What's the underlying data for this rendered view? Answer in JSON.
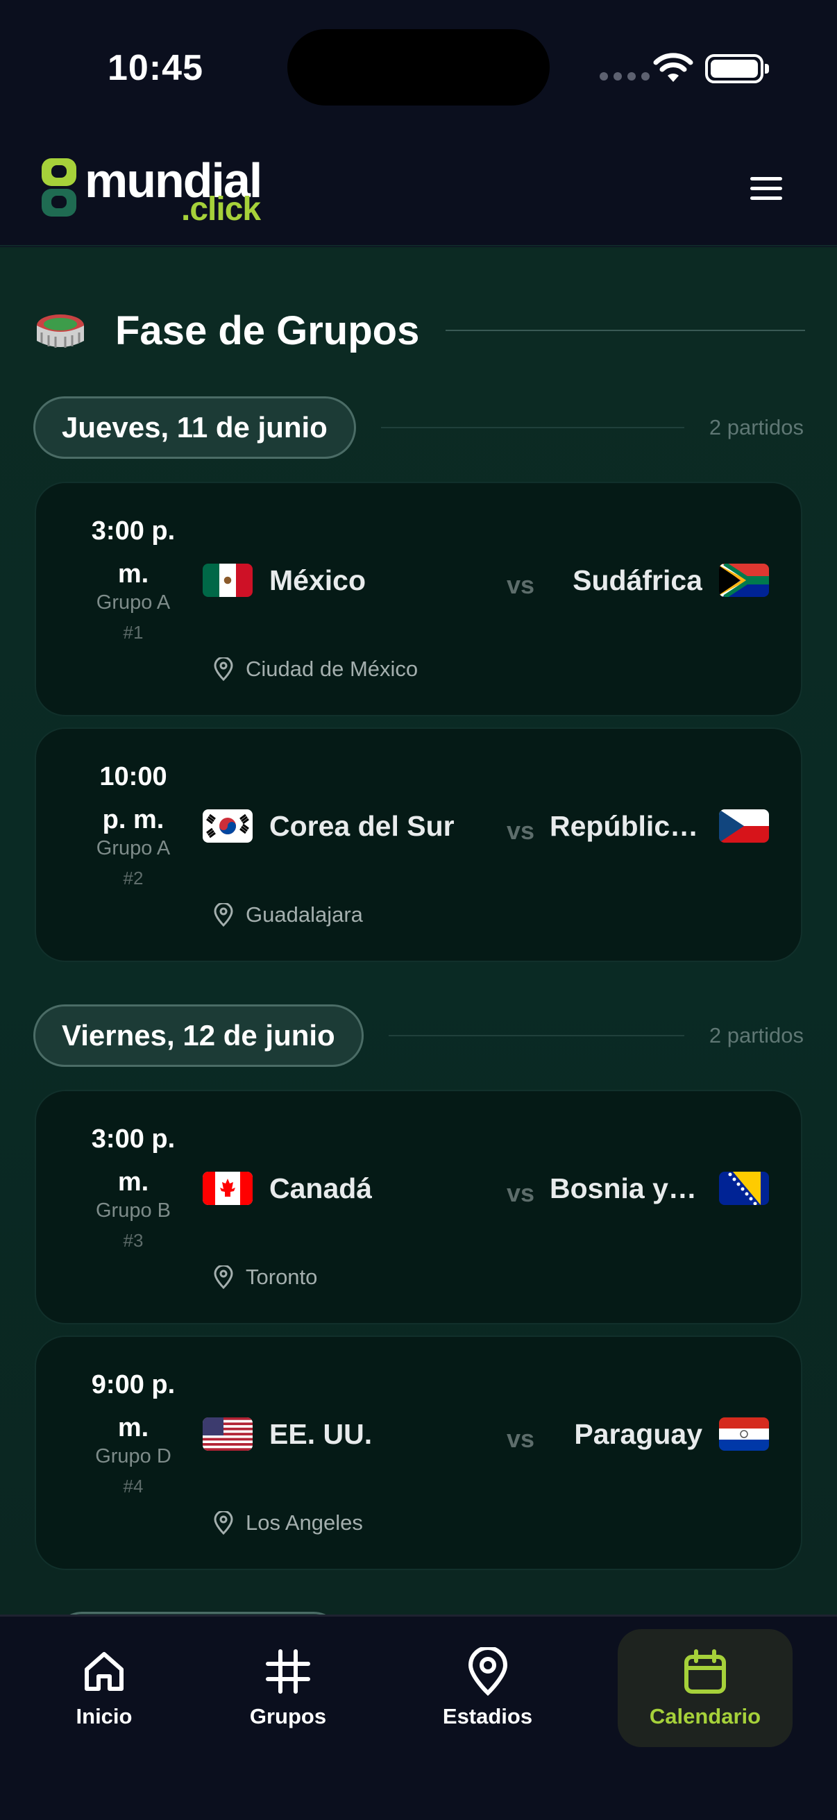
{
  "status_bar": {
    "time": "10:45"
  },
  "header": {
    "logo_text": "mundial",
    "logo_sub": ".click"
  },
  "section": {
    "title": "Fase de Grupos"
  },
  "days": [
    {
      "label": "Jueves, 11 de junio",
      "count": "2 partidos",
      "matches": [
        {
          "time_line1": "3:00 p.",
          "time_line2": "m.",
          "group": "Grupo A",
          "number": "#1",
          "home": "México",
          "home_flag": "mexico-flag",
          "away": "Sudáfrica",
          "away_flag": "south-africa-flag",
          "vs": "vs",
          "venue": "Ciudad de México"
        },
        {
          "time_line1": "10:00",
          "time_line2": "p. m.",
          "group": "Grupo A",
          "number": "#2",
          "home": "Corea del Sur",
          "home_flag": "south-korea-flag",
          "away": "República Checa",
          "away_flag": "czech-republic-flag",
          "vs": "vs",
          "venue": "Guadalajara"
        }
      ]
    },
    {
      "label": "Viernes, 12 de junio",
      "count": "2 partidos",
      "matches": [
        {
          "time_line1": "3:00 p.",
          "time_line2": "m.",
          "group": "Grupo B",
          "number": "#3",
          "home": "Canadá",
          "home_flag": "canada-flag",
          "away": "Bosnia y Herzegovina",
          "away_flag": "bosnia-flag",
          "vs": "vs",
          "venue": "Toronto"
        },
        {
          "time_line1": "9:00 p.",
          "time_line2": "m.",
          "group": "Grupo D",
          "number": "#4",
          "home": "EE. UU.",
          "home_flag": "usa-flag",
          "away": "Paraguay",
          "away_flag": "paraguay-flag",
          "vs": "vs",
          "venue": "Los Angeles"
        }
      ]
    }
  ],
  "nav": {
    "items": [
      {
        "label": "Inicio",
        "icon": "home-icon"
      },
      {
        "label": "Grupos",
        "icon": "hash-icon"
      },
      {
        "label": "Estadios",
        "icon": "location-pin-icon"
      },
      {
        "label": "Calendario",
        "icon": "calendar-icon",
        "active": true
      }
    ]
  },
  "colors": {
    "accent": "#a6d13a",
    "background": "#0b0f1e",
    "card": "#051a16",
    "content_bg": "#0c2a23"
  }
}
